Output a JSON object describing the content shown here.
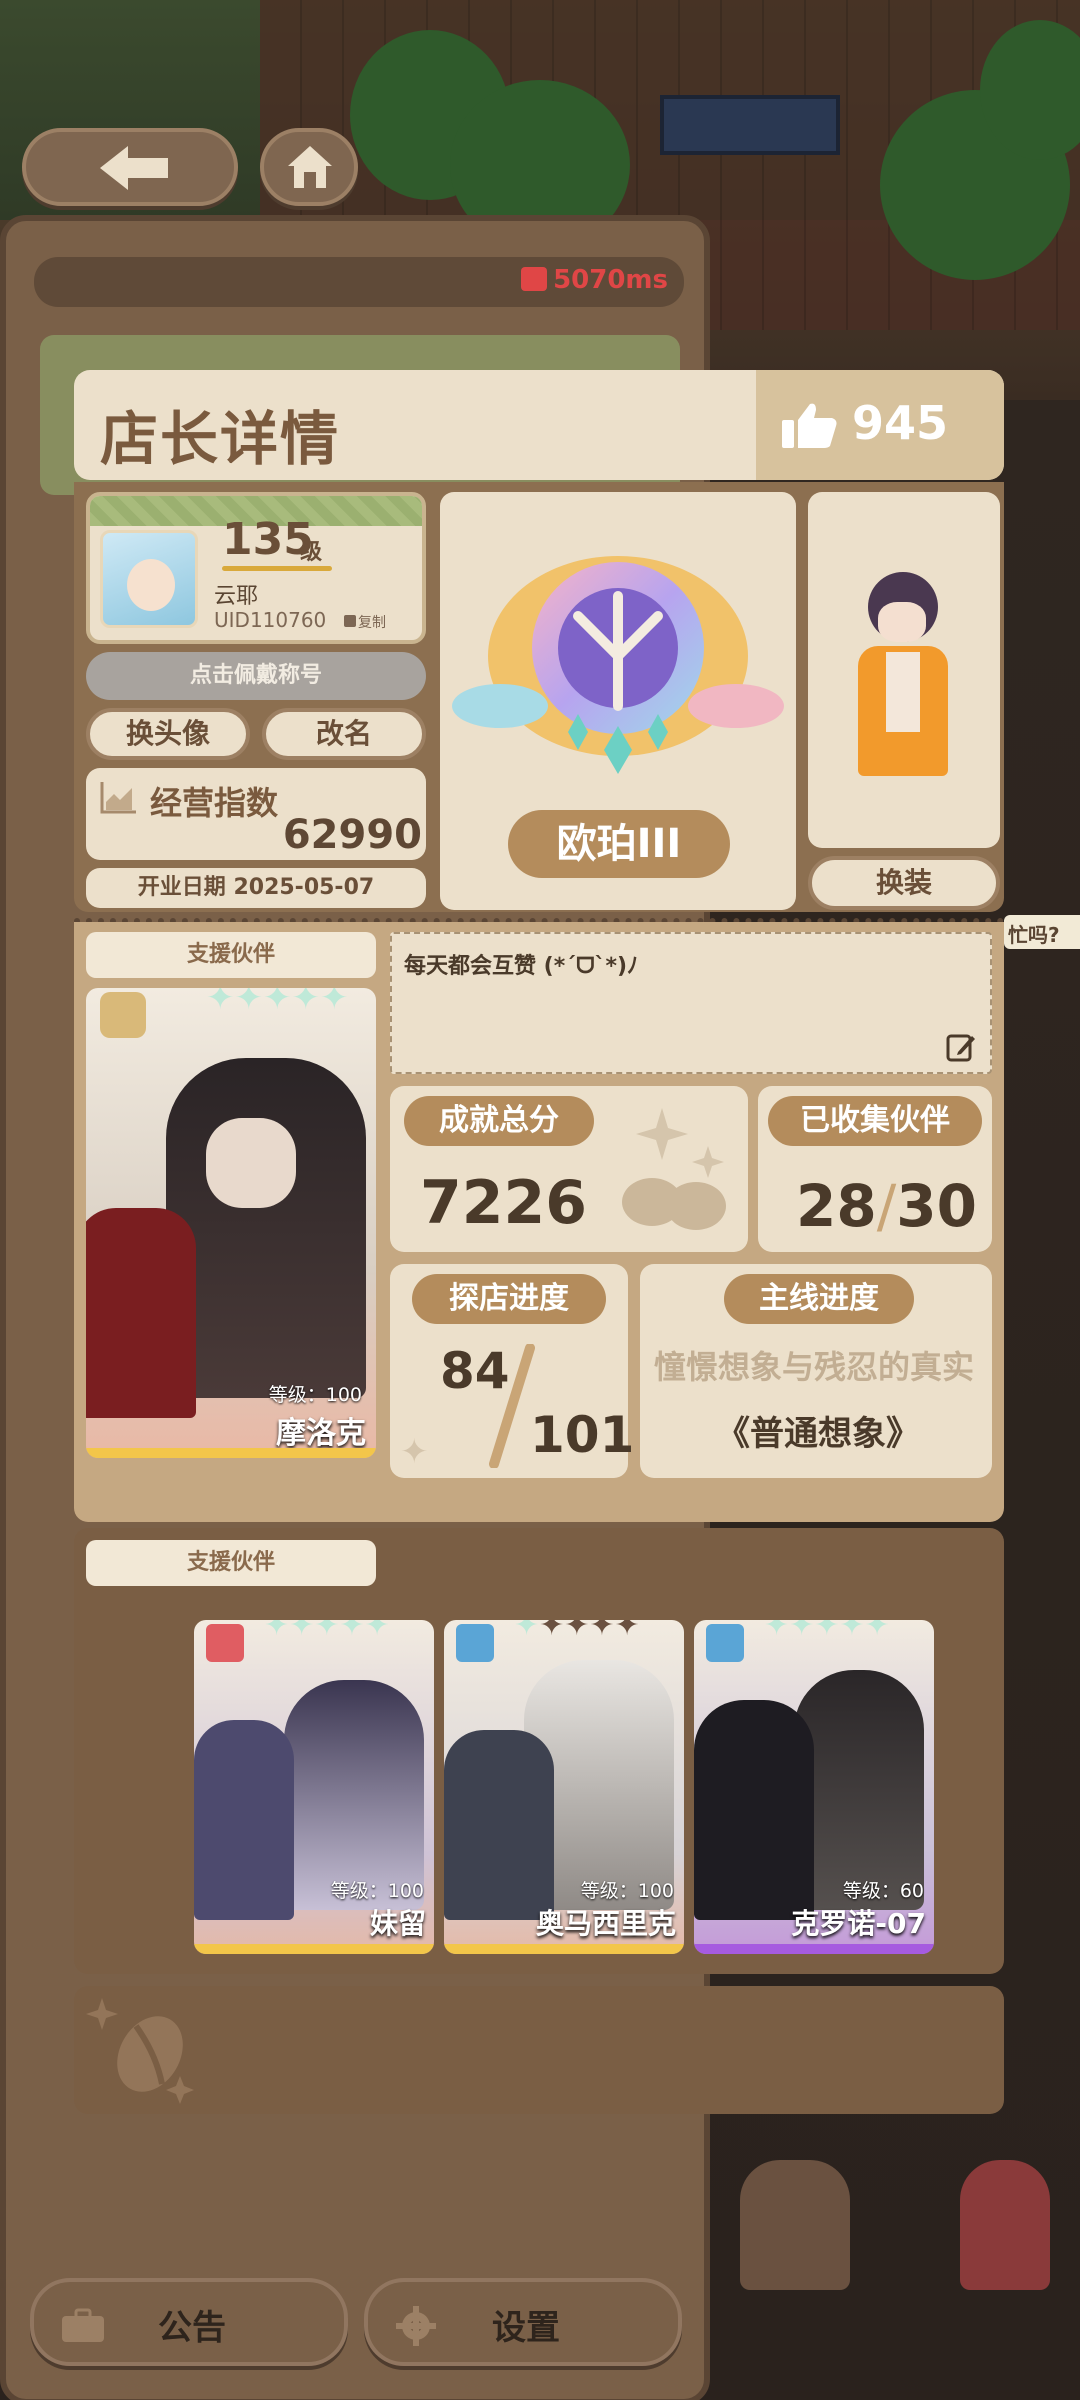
{
  "network": {
    "latency": "5070ms"
  },
  "header": {
    "title": "店长详情",
    "likes": "945"
  },
  "profile": {
    "level": "135",
    "level_unit": "级",
    "name": "云耶",
    "uid": "UID110760",
    "copy_label": "复制",
    "wear_title_label": "点击佩戴称号",
    "change_avatar_label": "换头像",
    "rename_label": "改名",
    "business_index_label": "经营指数",
    "business_index_value": "62990",
    "open_date": "开业日期 2025-05-07"
  },
  "rank": {
    "name": "欧珀III"
  },
  "outfit": {
    "change_label": "换装"
  },
  "support": {
    "section_label": "支援伙伴",
    "main_partner": {
      "name": "摩洛克",
      "level": "等级：100",
      "stars": 5
    }
  },
  "motto": {
    "text": "每天都会互赞 (*ˊᗜˋ*)ﾉ"
  },
  "stats": {
    "achievement_label": "成就总分",
    "achievement_value": "7226",
    "collected_label": "已收集伙伴",
    "collected_current": "28",
    "collected_total": "30",
    "explore_label": "探店进度",
    "explore_current": "84",
    "explore_total": "101",
    "mainline_label": "主线进度",
    "mainline_chapter": "憧憬想象与残忍的真实",
    "mainline_title": "《普通想象》"
  },
  "support2": {
    "section_label": "支援伙伴",
    "partners": [
      {
        "name": "妹留",
        "level": "等级：100",
        "stars": 5,
        "rarity": "gold"
      },
      {
        "name": "奥马西里克",
        "level": "等级：100",
        "stars": 5,
        "rarity": "gold"
      },
      {
        "name": "克罗诺-07",
        "level": "等级：60",
        "stars": 5,
        "rarity": "purple"
      }
    ]
  },
  "bottom": {
    "notice_label": "公告",
    "settings_label": "设置"
  },
  "colors": {
    "accent_brown": "#7a5e44",
    "cream": "#ece0cb",
    "gold": "#f3c64a",
    "purple": "#a65be0",
    "ping_red": "#e04646"
  }
}
